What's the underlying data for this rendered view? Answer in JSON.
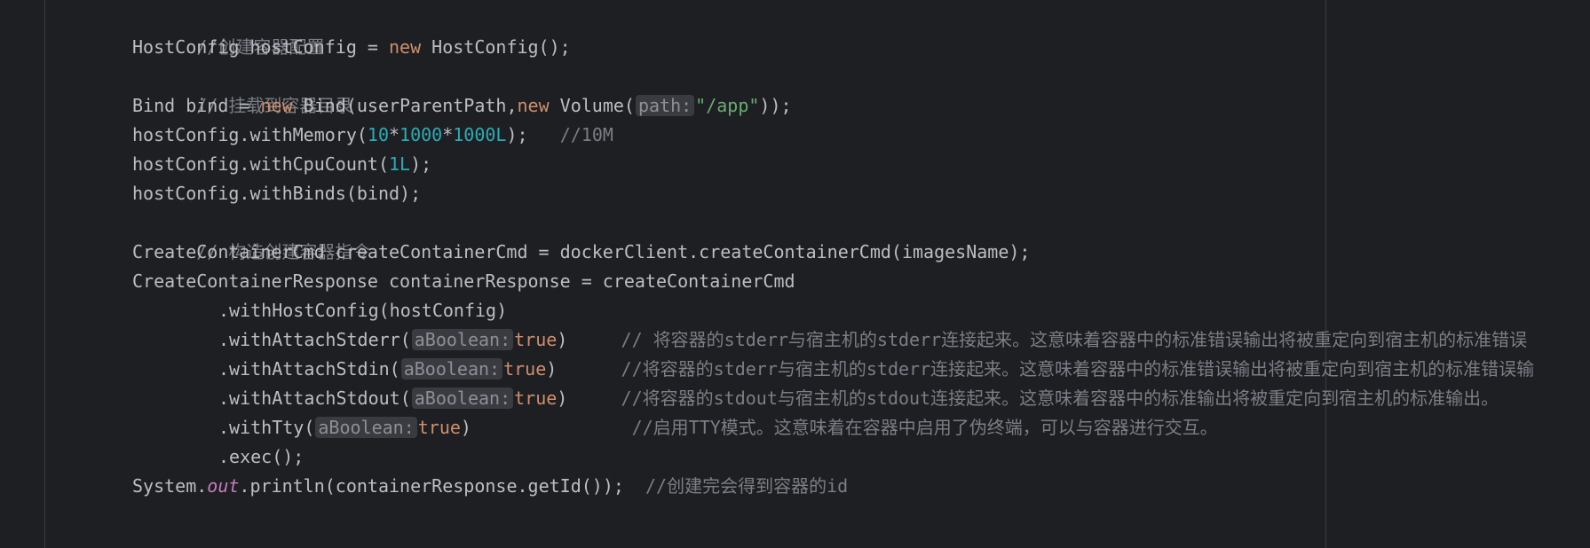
{
  "colors": {
    "background": "#1e1f22",
    "text": "#bcbec4",
    "keyword": "#cf8e6d",
    "number": "#2aacb8",
    "string": "#6aab73",
    "comment": "#7a7e85",
    "static_field": "#c77dbb",
    "inlay_hint_bg": "#393b40"
  },
  "code": {
    "l1": {
      "comment": "//创建容器配置"
    },
    "l2": {
      "a": "HostConfig hostConfig = ",
      "kw": "new",
      "b": " HostConfig();"
    },
    "l3": {
      "comment": "// 挂载到容器目录"
    },
    "l4": {
      "a": "Bind bind = ",
      "kw1": "new",
      "b": " Bind(userParentPath,",
      "kw2": "new",
      "c": " Volume(",
      "hint": "path:",
      "str": "\"/app\"",
      "d": "));"
    },
    "l5": {
      "a": "hostConfig.withMemory(",
      "n1": "10",
      "op1": "*",
      "n2": "1000",
      "op2": "*",
      "n3": "1000L",
      "b": ");   ",
      "comment": "//10M"
    },
    "l6": {
      "a": "hostConfig.withCpuCount(",
      "n1": "1L",
      "b": ");"
    },
    "l7": {
      "a": "hostConfig.withBinds(bind);"
    },
    "l8": {
      "comment": "// 构造创建容器指令"
    },
    "l9": {
      "a": "CreateContainerCmd createContainerCmd = dockerClient.createContainerCmd(imagesName);"
    },
    "l10": {
      "a": "CreateContainerResponse containerResponse = createContainerCmd"
    },
    "l11": {
      "a": ".withHostConfig(hostConfig)"
    },
    "l12": {
      "a": ".withAttachStderr(",
      "hint": "aBoolean:",
      "kw": "true",
      "b": ")     ",
      "comment": "// 将容器的stderr与宿主机的stderr连接起来。这意味着容器中的标准错误输出将被重定向到宿主机的标准错误"
    },
    "l13": {
      "a": ".withAttachStdin(",
      "hint": "aBoolean:",
      "kw": "true",
      "b": ")      ",
      "comment": "//将容器的stderr与宿主机的stderr连接起来。这意味着容器中的标准错误输出将被重定向到宿主机的标准错误输"
    },
    "l14": {
      "a": ".withAttachStdout(",
      "hint": "aBoolean:",
      "kw": "true",
      "b": ")     ",
      "comment": "//将容器的stdout与宿主机的stdout连接起来。这意味着容器中的标准输出将被重定向到宿主机的标准输出。"
    },
    "l15": {
      "a": ".withTty(",
      "hint": "aBoolean:",
      "kw": "true",
      "b": ")               ",
      "comment": "//启用TTY模式。这意味着在容器中启用了伪终端，可以与容器进行交互。"
    },
    "l16": {
      "a": ".exec();"
    },
    "l17": {
      "a": "System.",
      "field": "out",
      "b": ".println(containerResponse.getId());  ",
      "comment": "//创建完会得到容器的id"
    }
  }
}
